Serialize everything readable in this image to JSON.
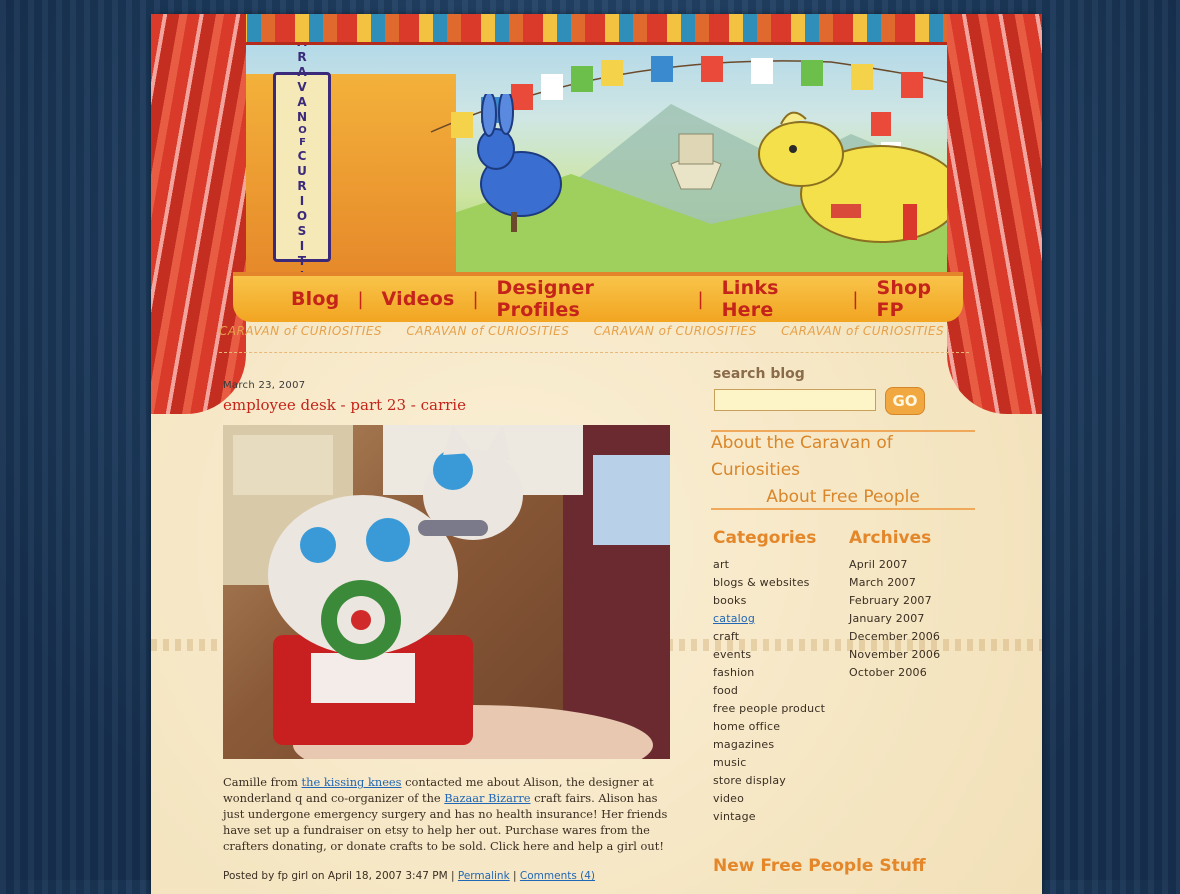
{
  "header": {
    "sign_words": [
      "CARAVAN",
      "OF",
      "CURIOSITIES"
    ],
    "tagline": "CARAVAN of CURIOSITIES"
  },
  "nav": {
    "items": [
      "Blog",
      "Videos",
      "Designer Profiles",
      "Links Here",
      "Shop FP"
    ]
  },
  "post": {
    "date": "March 23, 2007",
    "title": "employee desk - part 23 - carrie",
    "body": {
      "p1": "Camille from ",
      "link1": "the kissing knees",
      "p2": " contacted me about Alison, the designer at wonderland q and co-organizer of the ",
      "link2": "Bazaar Bizarre",
      "p3": " craft fairs. Alison has just undergone emergency surgery and has no health insurance! Her friends have set up a fundraiser on etsy  to help her out. Purchase wares from the crafters donating, or donate crafts to be sold. Click here and help a girl out!"
    },
    "meta": {
      "posted": "Posted by fp girl on April 18, 2007 3:47 PM | ",
      "permalink": "Permalink",
      "sep": " | ",
      "comments": "Comments (4)"
    }
  },
  "sidebar": {
    "search_label": "search blog",
    "search_value": "",
    "go_label": "GO",
    "about_links": [
      "About the Caravan of Curiosities",
      "About Free People"
    ],
    "categories_heading": "Categories",
    "categories": [
      "art",
      "blogs & websites",
      "books",
      "catalog",
      "craft",
      "events",
      "fashion",
      "food",
      "free people product",
      "home office",
      "magazines",
      "music",
      "store display",
      "video",
      "vintage"
    ],
    "active_category": "catalog",
    "archives_heading": "Archives",
    "archives": [
      "April 2007",
      "March 2007",
      "February 2007",
      "January 2007",
      "December 2006",
      "November 2006",
      "October 2006"
    ],
    "new_stuff_heading": "New Free People Stuff"
  },
  "colors": {
    "background": "#1d3a5c",
    "paper": "#f7e9c9",
    "title_red": "#c4241a",
    "link_blue": "#2267b5",
    "accent_orange": "#e4872a"
  }
}
